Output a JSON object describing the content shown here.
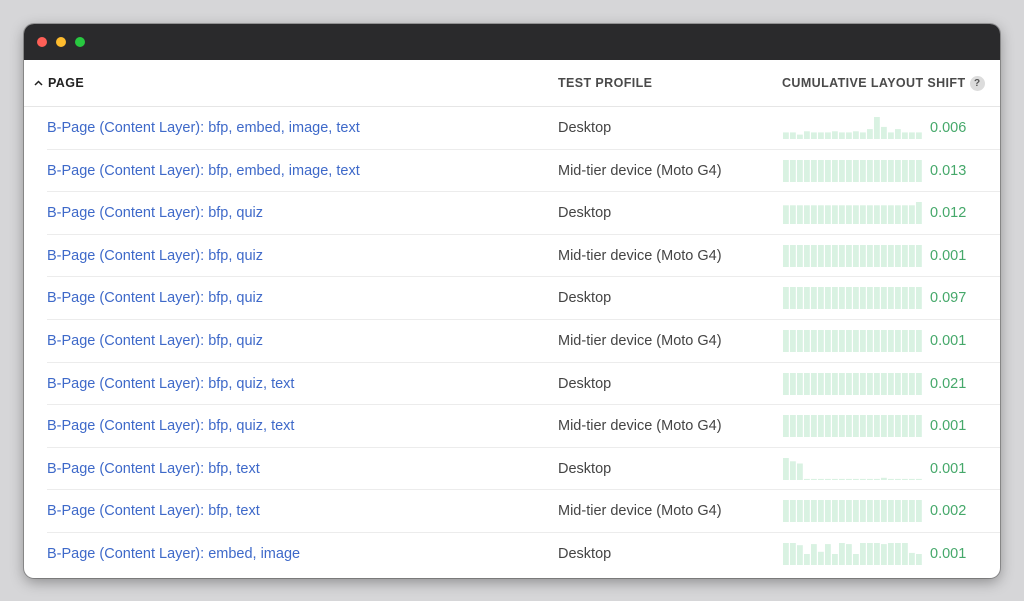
{
  "window": {
    "controls": [
      "close",
      "minimize",
      "zoom"
    ]
  },
  "table": {
    "headers": {
      "page": "PAGE",
      "test_profile": "TEST PROFILE",
      "cls": "CUMULATIVE LAYOUT SHIFT",
      "help": "?"
    },
    "sort_icon": "chevron-up-icon",
    "rows": [
      {
        "page": "B-Page (Content Layer): bfp, embed, image, text",
        "profile": "Desktop",
        "value": "0.006",
        "spark": [
          0.3,
          0.3,
          0.2,
          0.35,
          0.3,
          0.3,
          0.3,
          0.35,
          0.3,
          0.3,
          0.35,
          0.3,
          0.45,
          1.0,
          0.55,
          0.3,
          0.45,
          0.3,
          0.3,
          0.3
        ]
      },
      {
        "page": "B-Page (Content Layer): bfp, embed, image, text",
        "profile": "Mid-tier device (Moto G4)",
        "value": "0.013",
        "spark": [
          1,
          1,
          1,
          1,
          1,
          1,
          1,
          1,
          1,
          1,
          1,
          1,
          1,
          1,
          1,
          1,
          1,
          1,
          1,
          1
        ]
      },
      {
        "page": "B-Page (Content Layer): bfp, quiz",
        "profile": "Desktop",
        "value": "0.012",
        "spark": [
          0.85,
          0.85,
          0.85,
          0.85,
          0.85,
          0.85,
          0.85,
          0.85,
          0.85,
          0.85,
          0.85,
          0.85,
          0.85,
          0.85,
          0.85,
          0.85,
          0.85,
          0.85,
          0.85,
          1.0
        ]
      },
      {
        "page": "B-Page (Content Layer): bfp, quiz",
        "profile": "Mid-tier device (Moto G4)",
        "value": "0.001",
        "spark": [
          1,
          1,
          1,
          1,
          1,
          1,
          1,
          1,
          1,
          1,
          1,
          1,
          1,
          1,
          1,
          1,
          1,
          1,
          1,
          1
        ]
      },
      {
        "page": "B-Page (Content Layer): bfp, quiz",
        "profile": "Desktop",
        "value": "0.097",
        "spark": [
          1,
          1,
          1,
          1,
          1,
          1,
          1,
          1,
          1,
          1,
          1,
          1,
          1,
          1,
          1,
          1,
          1,
          1,
          1,
          1
        ]
      },
      {
        "page": "B-Page (Content Layer): bfp, quiz",
        "profile": "Mid-tier device (Moto G4)",
        "value": "0.001",
        "spark": [
          1,
          1,
          1,
          1,
          1,
          1,
          1,
          1,
          1,
          1,
          1,
          1,
          1,
          1,
          1,
          1,
          1,
          1,
          1,
          1
        ]
      },
      {
        "page": "B-Page (Content Layer): bfp, quiz, text",
        "profile": "Desktop",
        "value": "0.021",
        "spark": [
          1,
          1,
          1,
          1,
          1,
          1,
          1,
          1,
          1,
          1,
          1,
          1,
          1,
          1,
          1,
          1,
          1,
          1,
          1,
          1
        ]
      },
      {
        "page": "B-Page (Content Layer): bfp, quiz, text",
        "profile": "Mid-tier device (Moto G4)",
        "value": "0.001",
        "spark": [
          1,
          1,
          1,
          1,
          1,
          1,
          1,
          1,
          1,
          1,
          1,
          1,
          1,
          1,
          1,
          1,
          1,
          1,
          1,
          1
        ]
      },
      {
        "page": "B-Page (Content Layer): bfp, text",
        "profile": "Desktop",
        "value": "0.001",
        "spark": [
          1.0,
          0.85,
          0.75,
          0.05,
          0.05,
          0.05,
          0.05,
          0.05,
          0.05,
          0.05,
          0.05,
          0.05,
          0.05,
          0.05,
          0.1,
          0.05,
          0.05,
          0.05,
          0.05,
          0.05
        ]
      },
      {
        "page": "B-Page (Content Layer): bfp, text",
        "profile": "Mid-tier device (Moto G4)",
        "value": "0.002",
        "spark": [
          1,
          1,
          1,
          1,
          1,
          1,
          1,
          1,
          1,
          1,
          1,
          1,
          1,
          1,
          1,
          1,
          1,
          1,
          1,
          1
        ]
      },
      {
        "page": "B-Page (Content Layer): embed, image",
        "profile": "Desktop",
        "value": "0.001",
        "spark": [
          1,
          1,
          0.9,
          0.5,
          0.95,
          0.6,
          0.95,
          0.5,
          1,
          0.95,
          0.5,
          1,
          1,
          1,
          0.95,
          1,
          1,
          1,
          0.55,
          0.5
        ]
      }
    ]
  },
  "colors": {
    "link": "#3e69c9",
    "value": "#45a86a",
    "spark_bar": "#d9f2e2"
  }
}
